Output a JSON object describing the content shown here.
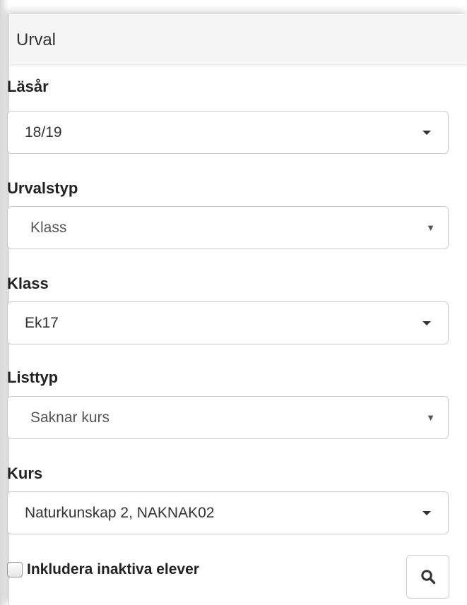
{
  "panel": {
    "title": "Urval"
  },
  "fields": {
    "lasar": {
      "label": "Läsår",
      "value": "18/19"
    },
    "urvalstyp": {
      "label": "Urvalstyp",
      "value": "Klass"
    },
    "klass": {
      "label": "Klass",
      "value": "Ek17"
    },
    "listtyp": {
      "label": "Listtyp",
      "value": "Saknar kurs"
    },
    "kurs": {
      "label": "Kurs",
      "value": "Naturkunskap 2, NAKNAK02"
    }
  },
  "options": {
    "include_inactive_label": "Inkludera inaktiva elever",
    "include_inactive_checked": false
  },
  "icons": {
    "search": "search-icon",
    "dropdown": "caret-down-icon",
    "native_dropdown": "select-arrow-icon"
  }
}
